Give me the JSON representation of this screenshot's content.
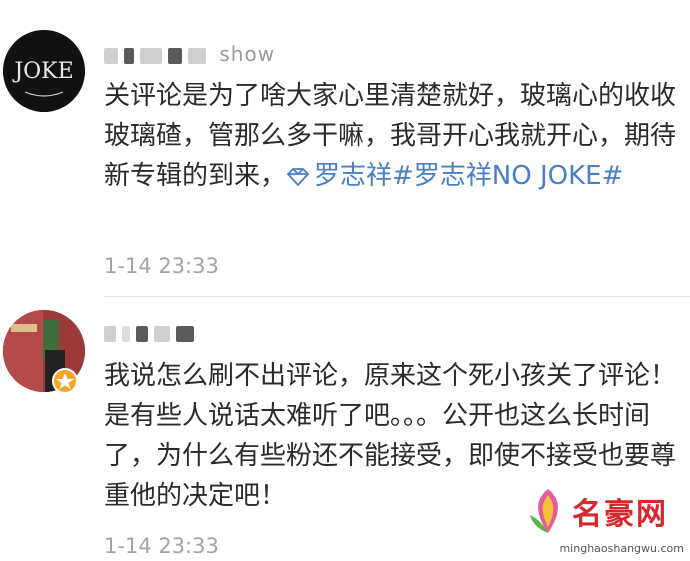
{
  "comments": [
    {
      "username_visible": "show",
      "avatar_text": "JOKE",
      "body": "关评论是为了啥大家心里清楚就好，玻璃心的收收玻璃碴，管那么多干嘛，我哥开心我就开心，期待新专辑的到来，",
      "topic": "罗志祥#罗志祥NO JOKE#",
      "time": "1-14 23:33"
    },
    {
      "username_visible": "",
      "body": "我说怎么刷不出评论，原来这个死小孩关了评论！是有些人说话太难听了吧。。。公开也这么长时间了，为什么有些粉还不能接受，即使不接受也要尊重他的决定吧！",
      "time": "1-14 23:33"
    }
  ],
  "watermark": {
    "title": "名豪网",
    "url": "minghaoshangwu.com"
  },
  "colors": {
    "topic": "#4a7fc6",
    "time": "#a4a4a4",
    "watermark_red": "#d7262d"
  }
}
